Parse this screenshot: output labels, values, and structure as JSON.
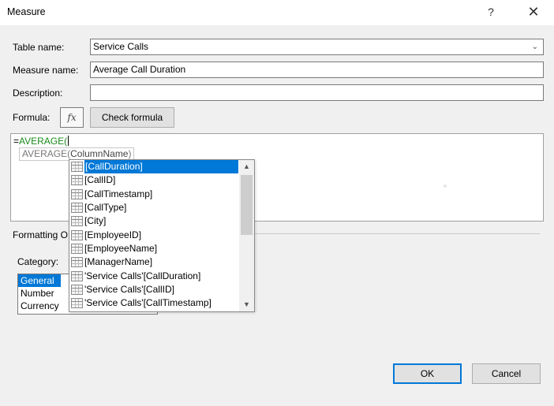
{
  "window": {
    "title": "Measure",
    "help_glyph": "?",
    "close_glyph": "✕"
  },
  "form": {
    "table_name_label": "Table name:",
    "table_name_value": "Service Calls",
    "measure_name_label": "Measure name:",
    "measure_name_value": "Average Call Duration",
    "description_label": "Description:",
    "description_value": "",
    "formula_label": "Formula:",
    "fx_label": "fx",
    "check_formula_label": "Check formula"
  },
  "editor": {
    "formula_prefix": "=",
    "formula_function": "AVERAGE(",
    "tooltip_function": "AVERAGE(",
    "tooltip_arg": "ColumnName",
    "tooltip_close": ")"
  },
  "autocomplete": {
    "items": [
      {
        "label": "[CallDuration]",
        "selected": true
      },
      {
        "label": "[CallID]"
      },
      {
        "label": "[CallTimestamp]"
      },
      {
        "label": "[CallType]"
      },
      {
        "label": "[City]"
      },
      {
        "label": "[EmployeeID]"
      },
      {
        "label": "[EmployeeName]"
      },
      {
        "label": "[ManagerName]"
      },
      {
        "label": "'Service Calls'[CallDuration]"
      },
      {
        "label": "'Service Calls'[CallID]"
      },
      {
        "label": "'Service Calls'[CallTimestamp]"
      }
    ]
  },
  "formatting": {
    "section_label": "Formatting O",
    "category_label": "Category:",
    "categories": [
      "General",
      "Number",
      "Currency"
    ],
    "selected_category": "General"
  },
  "buttons": {
    "ok": "OK",
    "cancel": "Cancel"
  },
  "colors": {
    "accent": "#0078d7",
    "function_green": "#1a8a1a"
  }
}
